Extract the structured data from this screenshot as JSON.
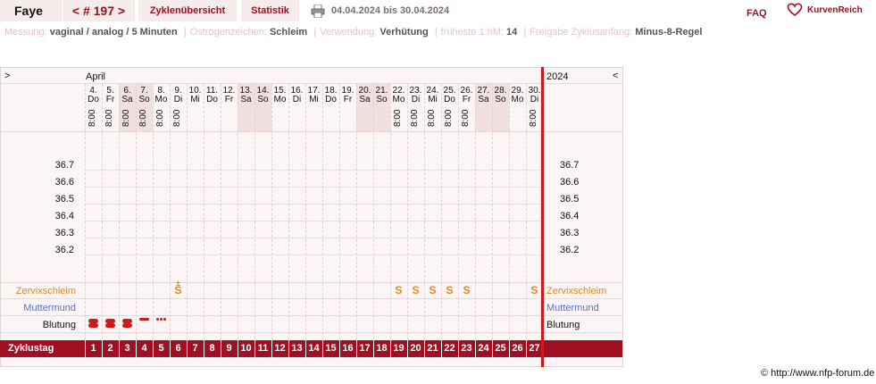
{
  "header": {
    "name": "Faye",
    "cycle": "< # 197 >",
    "tabs": [
      "Zyklenübersicht",
      "Statistik"
    ],
    "date_range": "04.04.2024 bis 30.04.2024",
    "faq": "FAQ",
    "logo": "KurvenReich"
  },
  "settings": [
    {
      "label": "Messung:",
      "value": "vaginal / analog / 5 Minuten"
    },
    {
      "label": "Östrogenzeichen:",
      "value": "Schleim"
    },
    {
      "label": "Verwendung:",
      "value": "Verhütung"
    },
    {
      "label": "früheste 1.hM:",
      "value": "14"
    },
    {
      "label": "Freigabe Zyklusanfang:",
      "value": "Minus-8-Regel"
    }
  ],
  "chart": {
    "left_arrow": ">",
    "right_arrow": "<",
    "month": "April",
    "year": "2024",
    "days": [
      {
        "num": "4.",
        "wd": "Do",
        "time": "8:00",
        "weekend": false
      },
      {
        "num": "5.",
        "wd": "Fr",
        "time": "8:00",
        "weekend": false
      },
      {
        "num": "6.",
        "wd": "Sa",
        "time": "8:00",
        "weekend": true
      },
      {
        "num": "7.",
        "wd": "So",
        "time": "8:00",
        "weekend": true
      },
      {
        "num": "8.",
        "wd": "Mo",
        "time": "8:00",
        "weekend": false
      },
      {
        "num": "9.",
        "wd": "Di",
        "time": "8:00",
        "weekend": false
      },
      {
        "num": "10.",
        "wd": "Mi",
        "time": "",
        "weekend": false
      },
      {
        "num": "11.",
        "wd": "Do",
        "time": "",
        "weekend": false
      },
      {
        "num": "12.",
        "wd": "Fr",
        "time": "",
        "weekend": false
      },
      {
        "num": "13.",
        "wd": "Sa",
        "time": "",
        "weekend": true
      },
      {
        "num": "14.",
        "wd": "So",
        "time": "",
        "weekend": true
      },
      {
        "num": "15.",
        "wd": "Mo",
        "time": "",
        "weekend": false
      },
      {
        "num": "16.",
        "wd": "Di",
        "time": "",
        "weekend": false
      },
      {
        "num": "17.",
        "wd": "Mi",
        "time": "",
        "weekend": false
      },
      {
        "num": "18.",
        "wd": "Do",
        "time": "",
        "weekend": false
      },
      {
        "num": "19.",
        "wd": "Fr",
        "time": "",
        "weekend": false
      },
      {
        "num": "20.",
        "wd": "Sa",
        "time": "",
        "weekend": true
      },
      {
        "num": "21.",
        "wd": "So",
        "time": "",
        "weekend": true
      },
      {
        "num": "22.",
        "wd": "Mo",
        "time": "8:00",
        "weekend": false
      },
      {
        "num": "23.",
        "wd": "Di",
        "time": "8:00",
        "weekend": false
      },
      {
        "num": "24.",
        "wd": "Mi",
        "time": "8:00",
        "weekend": false
      },
      {
        "num": "25.",
        "wd": "Do",
        "time": "8:00",
        "weekend": false
      },
      {
        "num": "26.",
        "wd": "Fr",
        "time": "8:00",
        "weekend": false
      },
      {
        "num": "27.",
        "wd": "Sa",
        "time": "",
        "weekend": true
      },
      {
        "num": "28.",
        "wd": "So",
        "time": "",
        "weekend": true
      },
      {
        "num": "29.",
        "wd": "Mo",
        "time": "",
        "weekend": false
      },
      {
        "num": "30.",
        "wd": "Di",
        "time": "8:00",
        "weekend": false
      }
    ],
    "temps": [
      "36.7",
      "36.6",
      "36.5",
      "36.4",
      "36.3",
      "36.2"
    ],
    "rows": {
      "mucus": "Zervixschleim",
      "cervix": "Muttermund",
      "bleeding": "Blutung",
      "cycle_day": "Zyklustag"
    },
    "mucus_marks": [
      {
        "day_index": 5,
        "symbol": "S",
        "top": "±"
      },
      {
        "day_index": 18,
        "symbol": "S"
      },
      {
        "day_index": 19,
        "symbol": "S"
      },
      {
        "day_index": 20,
        "symbol": "S"
      },
      {
        "day_index": 21,
        "symbol": "S"
      },
      {
        "day_index": 22,
        "symbol": "S"
      },
      {
        "day_index": 26,
        "symbol": "S"
      }
    ],
    "bleeding": [
      {
        "day_index": 0,
        "level": "strong"
      },
      {
        "day_index": 1,
        "level": "strong"
      },
      {
        "day_index": 2,
        "level": "strong"
      },
      {
        "day_index": 3,
        "level": "medium"
      },
      {
        "day_index": 4,
        "level": "spotting"
      }
    ],
    "cycle_days": [
      "1",
      "2",
      "3",
      "4",
      "5",
      "6",
      "7",
      "8",
      "9",
      "10",
      "11",
      "12",
      "13",
      "14",
      "15",
      "16",
      "17",
      "18",
      "19",
      "20",
      "21",
      "22",
      "23",
      "24",
      "25",
      "26",
      "27"
    ],
    "colors": {
      "accent": "#a00f22",
      "mucus": "#e08a1e",
      "cervix": "#5570c8",
      "bleeding": "#cc1a1a",
      "weekend": "#f1e0e0"
    }
  },
  "footer": {
    "copyright": "© http://www.nfp-forum.de"
  }
}
